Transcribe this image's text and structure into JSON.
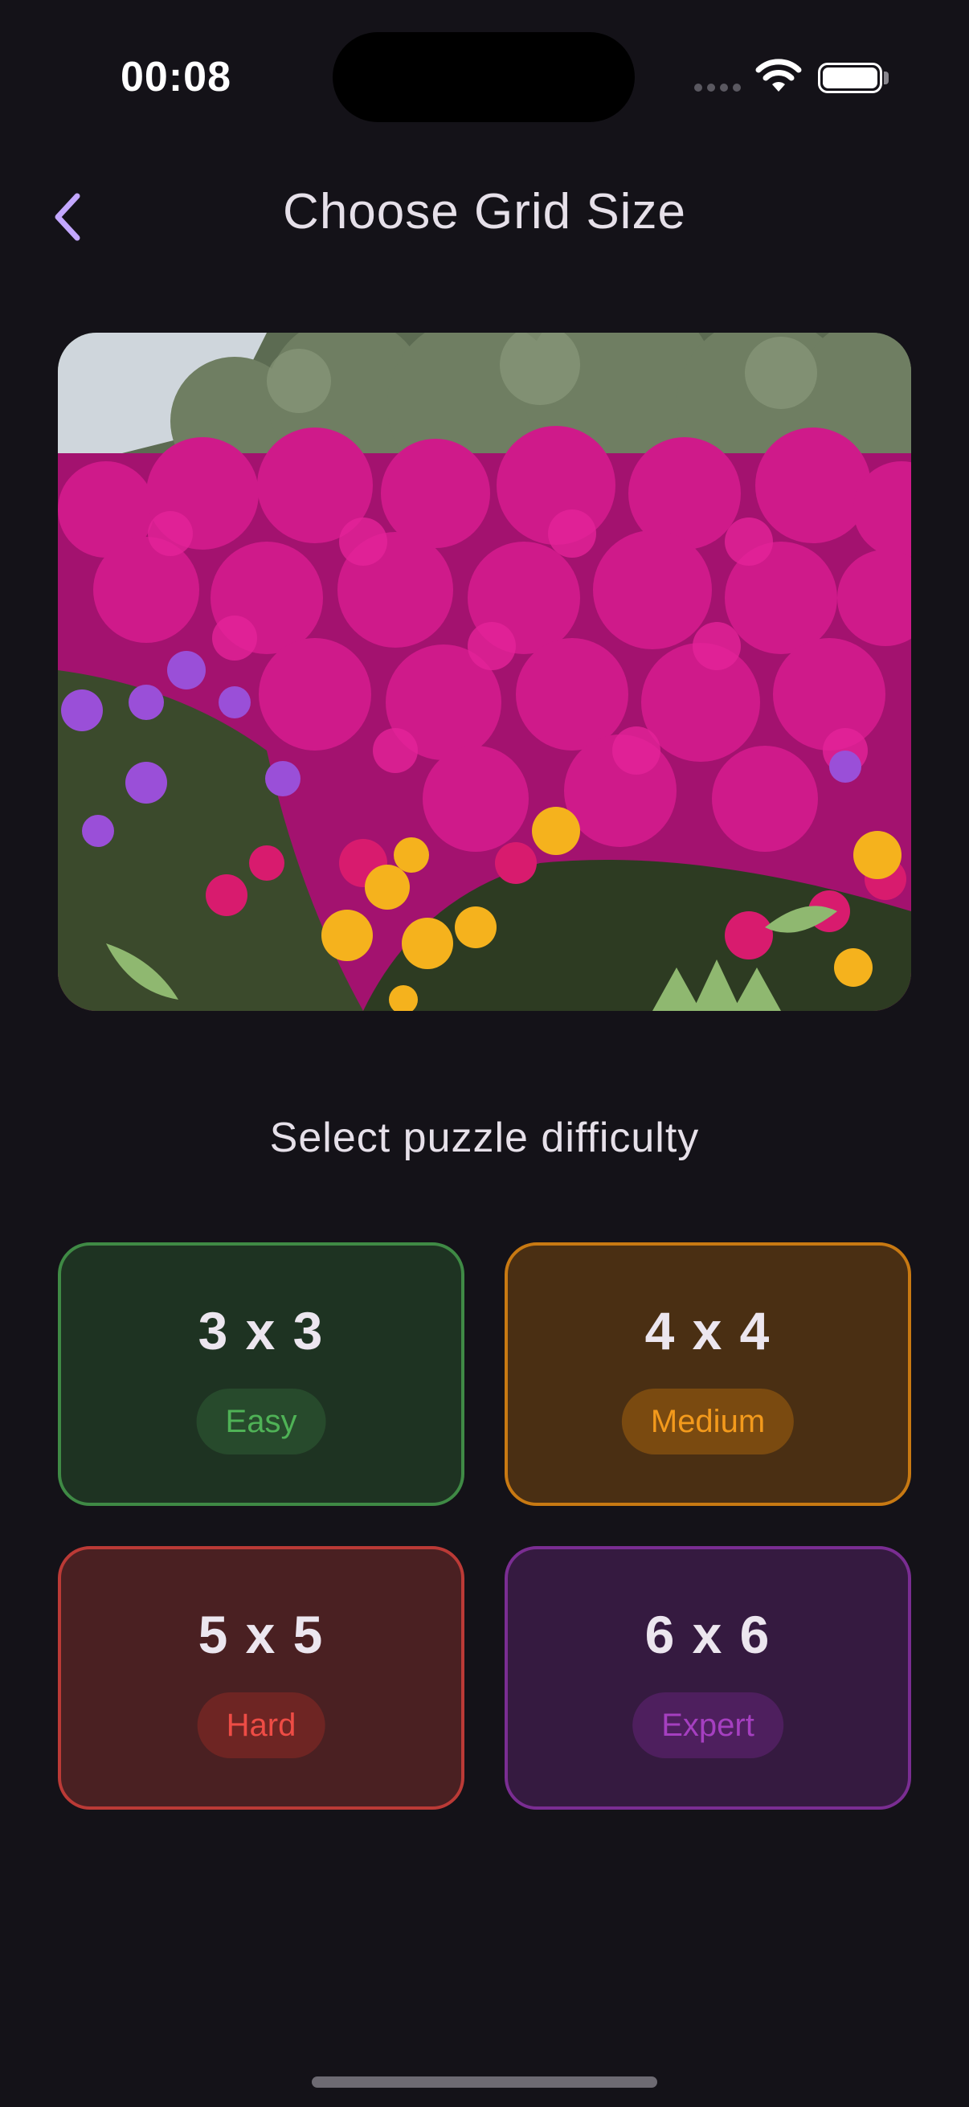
{
  "status_bar": {
    "time": "00:08"
  },
  "header": {
    "title": "Choose Grid Size"
  },
  "image": {
    "alt": "Field of magenta and yellow ice plant flowers"
  },
  "subtitle": "Select puzzle difficulty",
  "options": [
    {
      "size": "3 x 3",
      "level": "Easy",
      "accent": "#4fb256"
    },
    {
      "size": "4 x 4",
      "level": "Medium",
      "accent": "#f39a1c"
    },
    {
      "size": "5 x 5",
      "level": "Hard",
      "accent": "#ee4c45"
    },
    {
      "size": "6 x 6",
      "level": "Expert",
      "accent": "#a53fc0"
    }
  ],
  "icons": {
    "back": "chevron-left-icon",
    "wifi": "wifi-icon",
    "battery": "battery-icon",
    "signal": "cellular-signal-icon"
  },
  "colors": {
    "background": "#141218",
    "back_accent": "#c3a7ff"
  }
}
